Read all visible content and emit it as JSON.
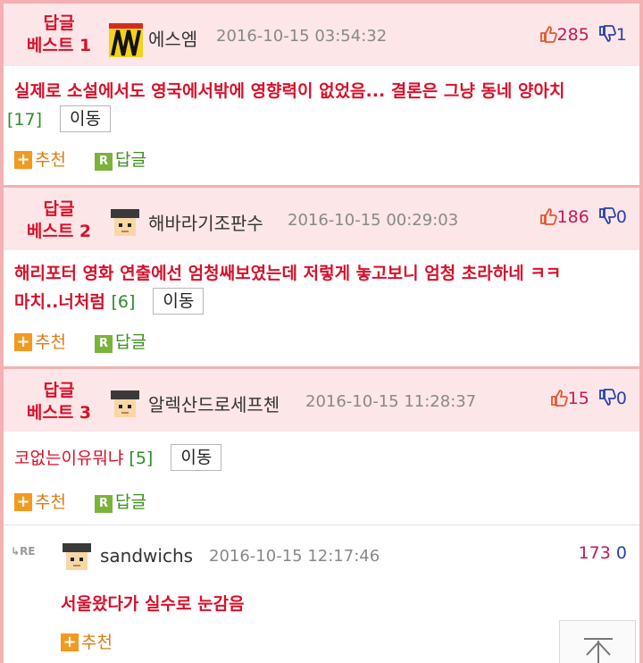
{
  "posts": [
    {
      "badge_line1": "답글",
      "badge_line2": "베스트 1",
      "nickname": "에스엠",
      "date": "2016-10-15 03:54:32",
      "up": "285",
      "down": "1",
      "text": "실제로 소설에서도 영국에서밖에 영향력이 없었음... 결론은 그냥 동네 양아치",
      "reply_count": "[17]",
      "move_label": "이동",
      "recommend_label": "추천",
      "reply_label": "답글"
    },
    {
      "badge_line1": "답글",
      "badge_line2": "베스트 2",
      "nickname": "해바라기조판수",
      "date": "2016-10-15 00:29:03",
      "up": "186",
      "down": "0",
      "text_line1": "해리포터 영화 연출에선 엄청쌔보였는데 저렇게 놓고보니 엄청 초라하네 ㅋㅋ",
      "text_line2": "마치..너처럼",
      "reply_count": "[6]",
      "move_label": "이동",
      "recommend_label": "추천",
      "reply_label": "답글"
    },
    {
      "badge_line1": "답글",
      "badge_line2": "베스트 3",
      "nickname": "알렉산드로세프첸",
      "date": "2016-10-15 11:28:37",
      "up": "15",
      "down": "0",
      "text": "코없는이유뭐냐",
      "reply_count": "[5]",
      "move_label": "이동",
      "recommend_label": "추천",
      "reply_label": "답글"
    }
  ],
  "reply": {
    "re_mark": "RE",
    "nickname": "sandwichs",
    "date": "2016-10-15 12:17:46",
    "up": "173",
    "down": "0",
    "text": "서울왔다가 실수로 눈감음",
    "recommend_label": "추천"
  },
  "icons": {
    "thumb_up": "thumbs-up-icon",
    "thumb_down": "thumbs-down-icon",
    "recommend": "plus-icon",
    "reply": "reply-r-icon",
    "scroll_top": "arrow-up-to-top-icon"
  },
  "colors": {
    "best_header_bg": "#fde6e7",
    "border": "#f3b1b4",
    "accent_red": "#d8102a",
    "up_count": "#c2185b",
    "down_count": "#2b3fb0",
    "reply_count": "#2e8b2e",
    "recommend": "#f39a1e",
    "reply_action": "#7bb33a"
  }
}
